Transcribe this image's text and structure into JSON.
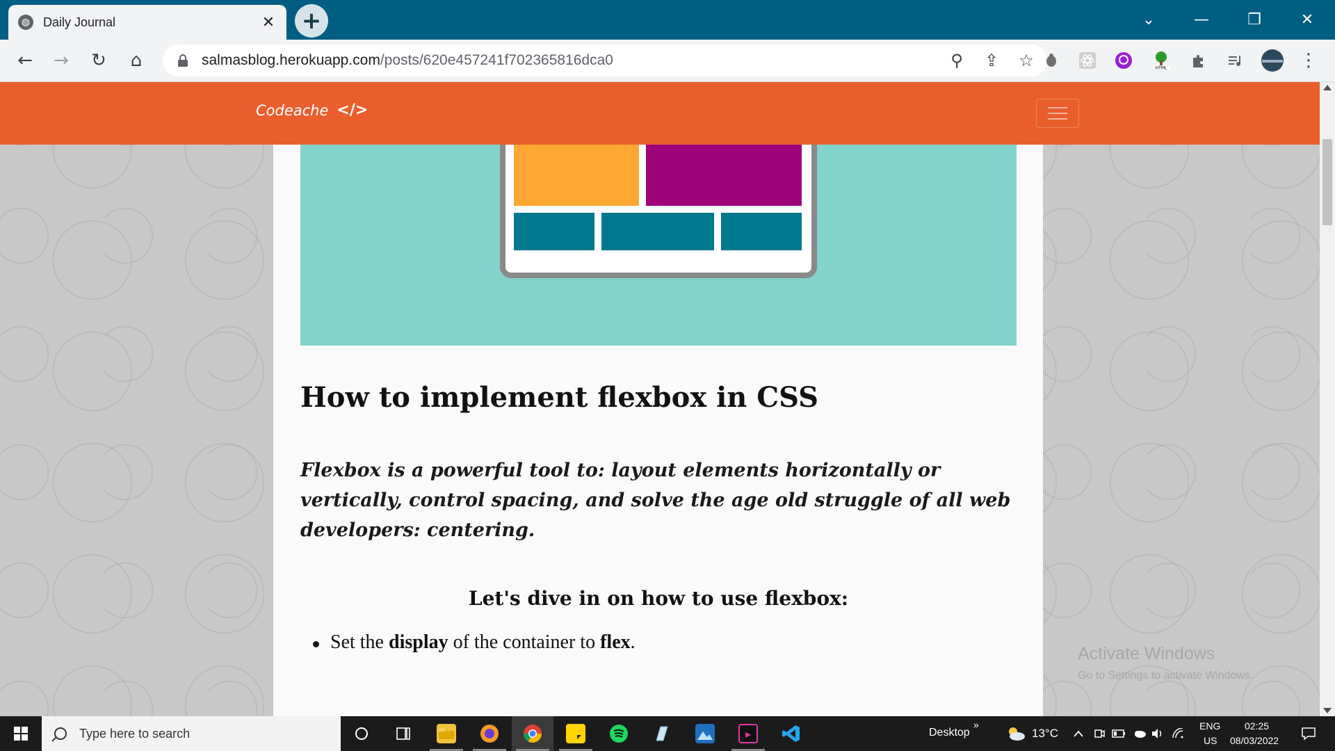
{
  "browser": {
    "tab_title": "Daily Journal",
    "tab_close": "✕",
    "new_tab": "+",
    "window_controls": {
      "tab_search": "⌄",
      "minimize": "—",
      "restore": "❐",
      "close": "✕"
    },
    "nav": {
      "back": "←",
      "forward": "→",
      "reload": "↻",
      "home": "⌂"
    },
    "url_host": "salmasblog.herokuapp.com",
    "url_path": "/posts/620e457241f702365816dca0",
    "omnibox_icons": {
      "zoom": "⚲",
      "share": "⇪",
      "bookmark": "☆"
    },
    "extensions": [
      "bug-extension-icon",
      "react-devtools-icon",
      "purple-extension-icon",
      "html-validator-icon",
      "extensions-puzzle-icon",
      "media-queue-icon"
    ],
    "menu": "⋮"
  },
  "site": {
    "brand": "Codeache",
    "brand_icon": "</>",
    "accent_color": "#ea5e2d"
  },
  "post": {
    "title": "How to implement flexbox in CSS",
    "lead": " Flexbox is a powerful tool to: layout elements horizontally or vertically, control spacing, and solve the age old struggle of all web developers: centering.",
    "section_heading": "Let's dive in on how to use flexbox:",
    "list": [
      {
        "pre": "Set the ",
        "b1": "display",
        "mid": " of the container to ",
        "b2": "flex",
        "post": "."
      }
    ],
    "hero_colors": {
      "background": "#82d3cb",
      "orange": "#ffa733",
      "purple": "#9e0279",
      "teal": "#00788f"
    }
  },
  "watermark": {
    "line1": "Activate Windows",
    "line2": "Go to Settings to activate Windows."
  },
  "taskbar": {
    "search_placeholder": "Type here to search",
    "apps": [
      "cortana-icon",
      "task-view-icon",
      "file-explorer-icon",
      "brave-browser-icon",
      "chrome-icon",
      "sticky-notes-icon",
      "spotify-icon",
      "pen-app-icon",
      "photos-icon",
      "terminal-icon",
      "vscode-icon"
    ],
    "desktop_label": "Desktop",
    "desktop_chevron": "»",
    "weather": "13°C",
    "lang_top": "ENG",
    "lang_bottom": "US",
    "time": "02:25",
    "date": "08/03/2022"
  }
}
